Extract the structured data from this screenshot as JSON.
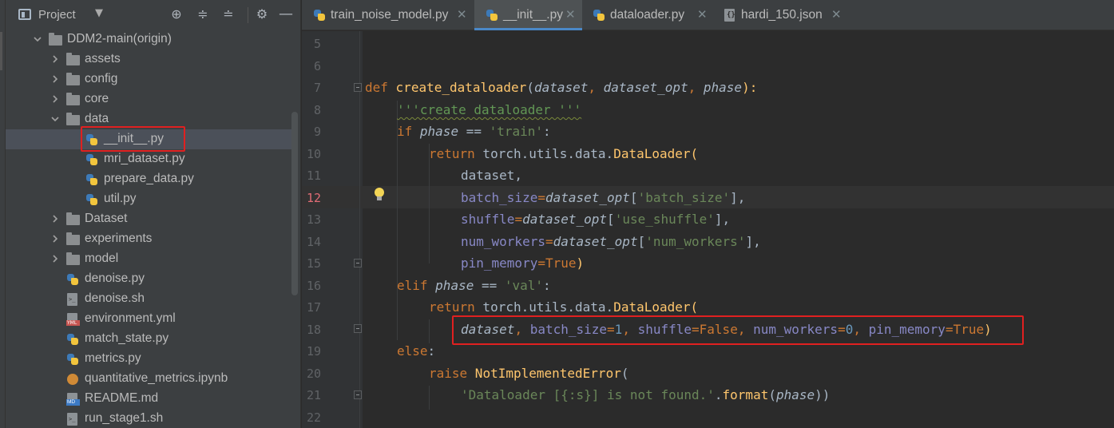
{
  "project_panel": {
    "title": "Project",
    "tree": [
      {
        "label": "DDM2-main(origin)",
        "type": "folder",
        "expanded": true,
        "depth": 0
      },
      {
        "label": "assets",
        "type": "folder",
        "expanded": false,
        "depth": 1
      },
      {
        "label": "config",
        "type": "folder",
        "expanded": false,
        "depth": 1
      },
      {
        "label": "core",
        "type": "folder",
        "expanded": false,
        "depth": 1
      },
      {
        "label": "data",
        "type": "folder",
        "expanded": true,
        "depth": 1
      },
      {
        "label": "__init__.py",
        "type": "python",
        "depth": 2,
        "selected": true
      },
      {
        "label": "mri_dataset.py",
        "type": "python",
        "depth": 2
      },
      {
        "label": "prepare_data.py",
        "type": "python",
        "depth": 2
      },
      {
        "label": "util.py",
        "type": "python",
        "depth": 2
      },
      {
        "label": "Dataset",
        "type": "folder",
        "expanded": false,
        "depth": 1
      },
      {
        "label": "experiments",
        "type": "folder",
        "expanded": false,
        "depth": 1
      },
      {
        "label": "model",
        "type": "folder",
        "expanded": false,
        "depth": 1
      },
      {
        "label": "denoise.py",
        "type": "python",
        "depth": 1
      },
      {
        "label": "denoise.sh",
        "type": "shell",
        "depth": 1
      },
      {
        "label": "environment.yml",
        "type": "yml",
        "depth": 1
      },
      {
        "label": "match_state.py",
        "type": "python",
        "depth": 1
      },
      {
        "label": "metrics.py",
        "type": "python",
        "depth": 1
      },
      {
        "label": "quantitative_metrics.ipynb",
        "type": "notebook",
        "depth": 1
      },
      {
        "label": "README.md",
        "type": "markdown",
        "depth": 1
      },
      {
        "label": "run_stage1.sh",
        "type": "shell",
        "depth": 1
      }
    ]
  },
  "tabs": [
    {
      "label": "train_noise_model.py",
      "active": false
    },
    {
      "label": "__init__.py",
      "active": true
    },
    {
      "label": "dataloader.py",
      "active": false
    },
    {
      "label": "hardi_150.json",
      "active": false
    }
  ],
  "editor": {
    "current_line": 12,
    "line_numbers": [
      "5",
      "6",
      "7",
      "8",
      "9",
      "10",
      "11",
      "12",
      "13",
      "14",
      "15",
      "16",
      "17",
      "18",
      "19",
      "20",
      "21",
      "22"
    ],
    "code": {
      "l7": {
        "kw": "def",
        "fn": "create_dataloader",
        "open": "(",
        "p1": "dataset",
        "c1": ", ",
        "p2": "dataset_opt",
        "c2": ", ",
        "p3": "phase",
        "close": "):"
      },
      "l8": {
        "doc": "'''create dataloader '''"
      },
      "l9": {
        "kw": "if",
        "param": "phase",
        "op": " == ",
        "st": "'train'",
        "end": ":"
      },
      "l10": {
        "kw": "return",
        "call": " torch.utils.data.",
        "cls": "DataLoader",
        "open": "("
      },
      "l11": {
        "text": "dataset,"
      },
      "l12": {
        "kwarg": "batch_size",
        "eq": "=",
        "param": "dataset_opt",
        "lb": "[",
        "st": "'batch_size'",
        "rb": "],"
      },
      "l13": {
        "kwarg": "shuffle",
        "eq": "=",
        "param": "dataset_opt",
        "lb": "[",
        "st": "'use_shuffle'",
        "rb": "],"
      },
      "l14": {
        "kwarg": "num_workers",
        "eq": "=",
        "param": "dataset_opt",
        "lb": "[",
        "st": "'num_workers'",
        "rb": "],"
      },
      "l15": {
        "kwarg": "pin_memory",
        "eq": "=",
        "val": "True",
        "end": ")"
      },
      "l16": {
        "kw": "elif",
        "param": "phase",
        "op": " == ",
        "st": "'val'",
        "end": ":"
      },
      "l17": {
        "kw": "return",
        "call": " torch.utils.data.",
        "cls": "DataLoader",
        "open": "("
      },
      "l18": {
        "p": "dataset",
        "c1": ", ",
        "k1": "batch_size",
        "e1": "=",
        "v1": "1",
        "c2": ", ",
        "k2": "shuffle",
        "e2": "=",
        "v2": "False",
        "c3": ", ",
        "k3": "num_workers",
        "e3": "=",
        "v3": "0",
        "c4": ", ",
        "k4": "pin_memory",
        "e4": "=",
        "v4": "True",
        "end": ")"
      },
      "l19": {
        "kw": "else",
        "end": ":"
      },
      "l20": {
        "kw": "raise",
        "cls": " NotImplementedError",
        "open": "("
      },
      "l21": {
        "st": "'Dataloader [{:s}] is not found.'",
        "dot": ".",
        "fn": "format",
        "open": "(",
        "param": "phase",
        "close": "))"
      }
    }
  },
  "colors": {
    "keyword": "#cc7832",
    "function": "#ffc66d",
    "string": "#6a8759",
    "number": "#6897bb",
    "kwarg": "#aa4926",
    "selection": "#4b5059",
    "highlight_box": "#e02020"
  }
}
